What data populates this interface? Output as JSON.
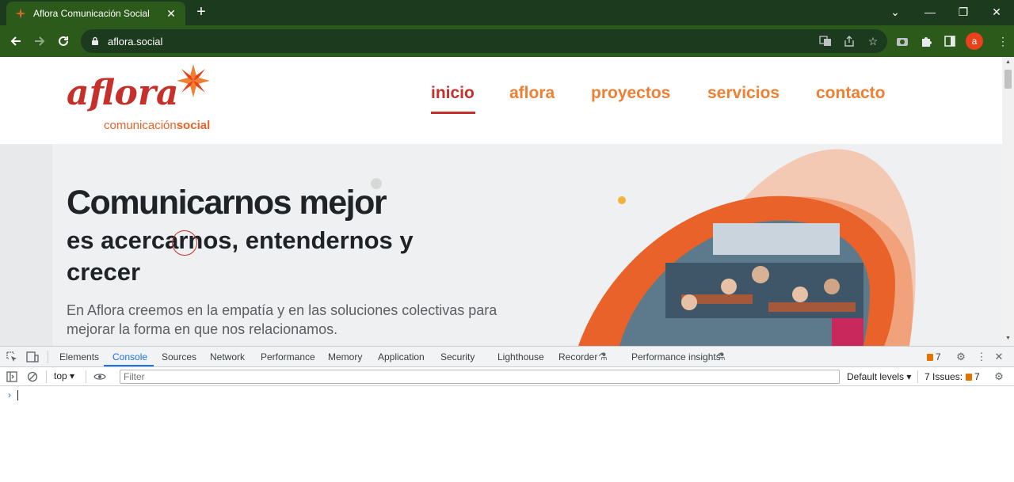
{
  "browser": {
    "tab_title": "Aflora Comunicación Social",
    "url": "aflora.social",
    "avatar_letter": "a"
  },
  "site": {
    "logo_text": "aflora",
    "logo_sub_regular": "comunicación",
    "logo_sub_bold": "social",
    "nav": [
      "inicio",
      "aflora",
      "proyectos",
      "servicios",
      "contacto"
    ],
    "active_nav": "inicio",
    "hero_title": "Comunicarnos mejor",
    "hero_subtitle": "es acercarnos, entendernos y crecer",
    "hero_text": "En Aflora creemos en la empatía y en las soluciones colectivas para mejorar la forma en que nos relacionamos.",
    "colors": {
      "brand_orange": "#ef7f33",
      "brand_red": "#c6302b",
      "chrome_green": "#2b5a1a"
    }
  },
  "devtools": {
    "tabs": [
      "Elements",
      "Console",
      "Sources",
      "Network",
      "Performance",
      "Memory",
      "Application",
      "Security",
      "Lighthouse",
      "Recorder",
      "Performance insights"
    ],
    "active_tab": "Console",
    "issue_badge_count": "7",
    "context": "top",
    "filter_placeholder": "Filter",
    "levels": "Default levels",
    "issues_label": "7 Issues:",
    "issues_count": "7",
    "prompt_symbol": "›"
  }
}
